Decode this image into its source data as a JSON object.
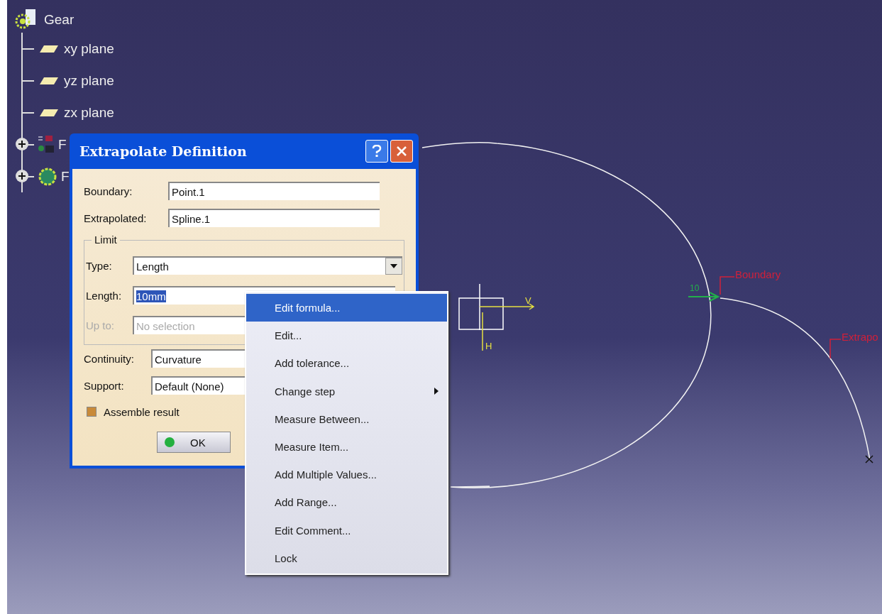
{
  "tree": {
    "label": "Gear",
    "children": [
      {
        "label": "xy plane",
        "kind": "plane",
        "expandable": false
      },
      {
        "label": "yz plane",
        "kind": "plane",
        "expandable": false
      },
      {
        "label": "zx plane",
        "kind": "plane",
        "expandable": false
      },
      {
        "label": "F",
        "kind": "parameters",
        "expandable": true
      },
      {
        "label": "F",
        "kind": "body",
        "expandable": true
      }
    ]
  },
  "dialog": {
    "title": "Extrapolate Definition",
    "fields": [
      {
        "label": "Boundary:",
        "value": "Point.1"
      },
      {
        "label": "Extrapolated:",
        "value": "Spline.1"
      }
    ],
    "limit": {
      "legend": "Limit",
      "type": {
        "label": "Type:",
        "value": "Length"
      },
      "length": {
        "label": "Length:",
        "value": "10mm",
        "highlighted": true
      },
      "up_to": {
        "label": "Up to:",
        "placeholder": "No selection",
        "disabled": true
      }
    },
    "continuity": {
      "label": "Continuity:",
      "value": "Curvature"
    },
    "support": {
      "label": "Support:",
      "value": "Default (None)"
    },
    "assemble": {
      "label": "Assemble result",
      "checked": true
    },
    "ok": "OK"
  },
  "context_menu": [
    {
      "label": "Edit formula...",
      "selected": true,
      "submenu": false
    },
    {
      "label": "Edit...",
      "selected": false,
      "submenu": false
    },
    {
      "label": "Add tolerance...",
      "selected": false,
      "submenu": false
    },
    {
      "label": "Change step",
      "selected": false,
      "submenu": true
    },
    {
      "label": "Measure Between...",
      "selected": false,
      "submenu": false
    },
    {
      "label": "Measure Item...",
      "selected": false,
      "submenu": false
    },
    {
      "label": "Add Multiple Values...",
      "selected": false,
      "submenu": false
    },
    {
      "label": "Add Range...",
      "selected": false,
      "submenu": false
    },
    {
      "label": "Edit Comment...",
      "selected": false,
      "submenu": false
    },
    {
      "label": "Lock",
      "selected": false,
      "submenu": false
    }
  ],
  "canvas": {
    "boundary_label": "Boundary",
    "extrapolated_label": "Extrapo",
    "dimension": "10",
    "axis_v": "V",
    "axis_h": "H"
  }
}
